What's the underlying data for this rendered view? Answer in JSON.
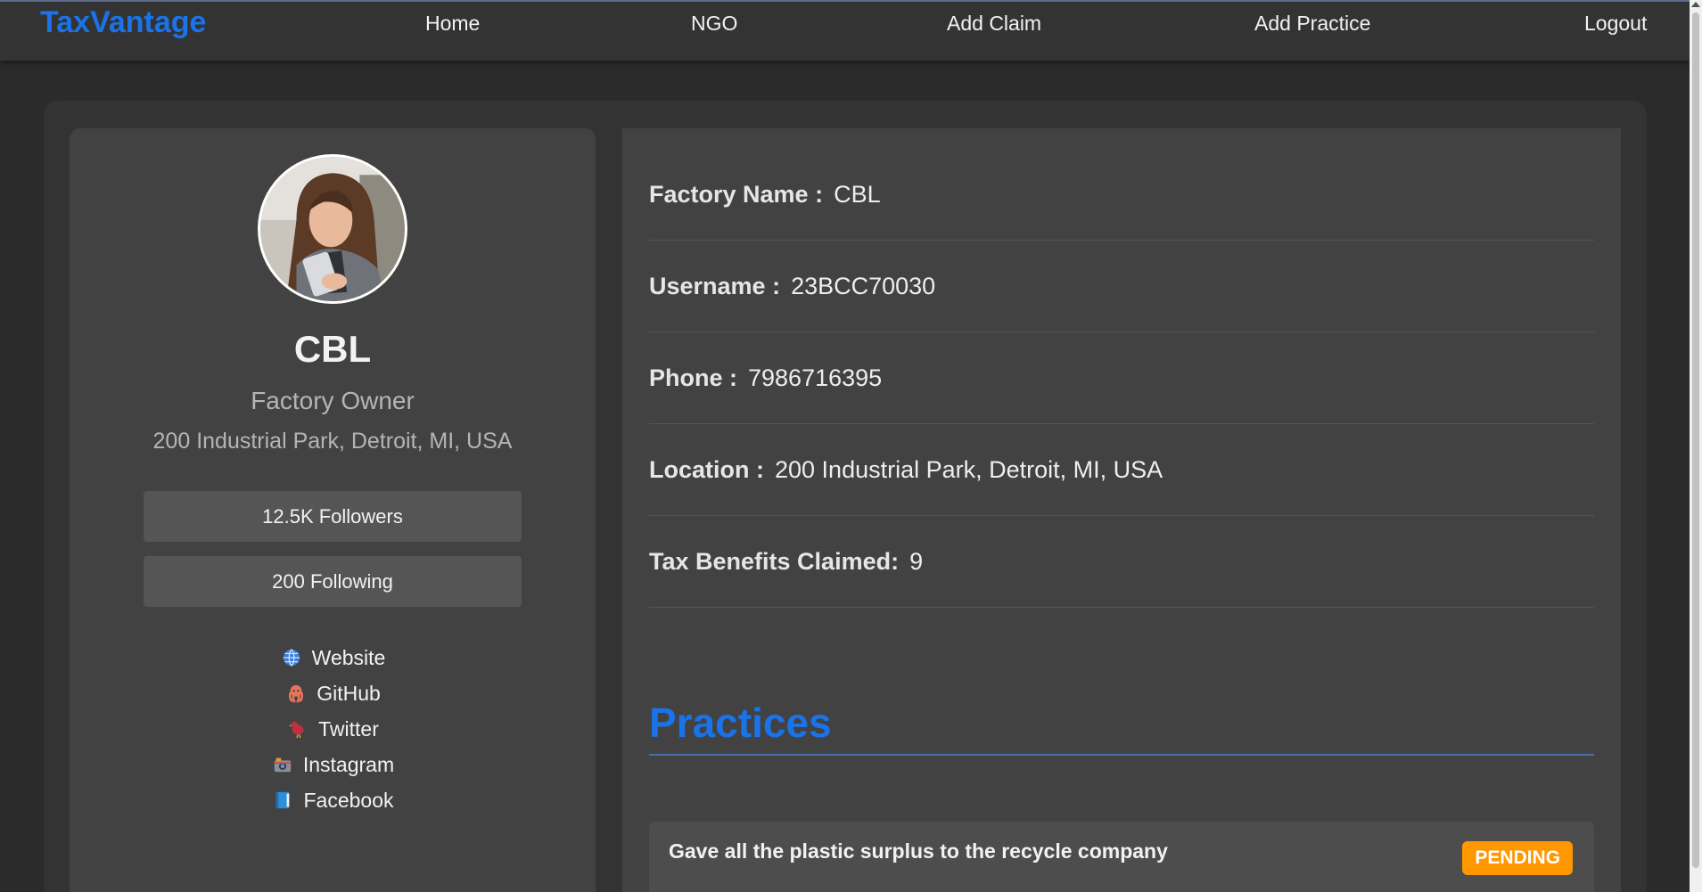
{
  "navbar": {
    "brand": "TaxVantage",
    "links": [
      "Home",
      "NGO",
      "Add Claim",
      "Add Practice",
      "Logout"
    ]
  },
  "profile": {
    "name": "CBL",
    "role": "Factory Owner",
    "address": "200 Industrial Park, Detroit, MI, USA",
    "followers": "12.5K Followers",
    "following": "200 Following",
    "social": [
      {
        "icon": "globe-icon",
        "label": "Website"
      },
      {
        "icon": "octopus-icon",
        "label": "GitHub"
      },
      {
        "icon": "bird-icon",
        "label": "Twitter"
      },
      {
        "icon": "camera-icon",
        "label": "Instagram"
      },
      {
        "icon": "book-icon",
        "label": "Facebook"
      }
    ]
  },
  "details": [
    {
      "key": "Factory Name :",
      "value": "CBL"
    },
    {
      "key": "Username :",
      "value": "23BCC70030"
    },
    {
      "key": "Phone :",
      "value": "7986716395"
    },
    {
      "key": "Location :",
      "value": "200 Industrial Park, Detroit, MI, USA"
    },
    {
      "key": "Tax Benefits Claimed:",
      "value": "9"
    }
  ],
  "practices": {
    "title": "Practices",
    "items": [
      {
        "text": "Gave all the plastic surplus to the recycle company",
        "status": "PENDING"
      }
    ]
  },
  "colors": {
    "accent": "#1a73e8",
    "pending": "#ff9800",
    "background": "#2b2b2b",
    "card": "#424242"
  }
}
